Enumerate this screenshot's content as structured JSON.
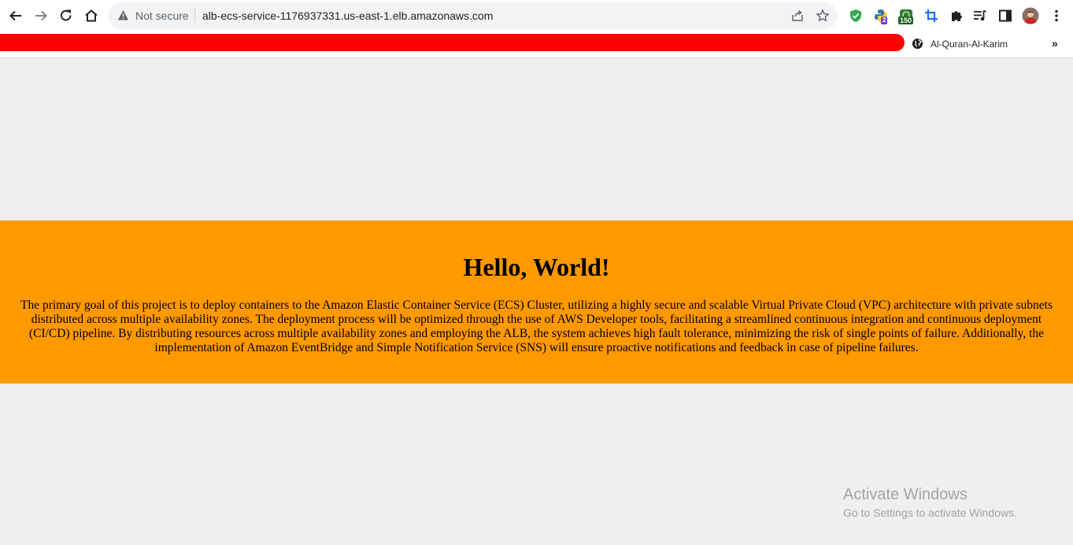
{
  "browser": {
    "back_icon": "arrow-left-icon",
    "forward_icon": "arrow-right-icon",
    "reload_icon": "reload-icon",
    "home_icon": "home-icon",
    "omnibox": {
      "security_label": "Not secure",
      "url": "alb-ecs-service-1176937331.us-east-1.elb.amazonaws.com"
    },
    "extensions": [
      {
        "name": "shield-extension-icon"
      },
      {
        "name": "python-extension-icon",
        "badge": "2"
      },
      {
        "name": "green-extension-icon",
        "badge": "150"
      },
      {
        "name": "crop-extension-icon"
      },
      {
        "name": "puzzle-extensions-icon"
      },
      {
        "name": "media-control-icon"
      },
      {
        "name": "side-panel-icon"
      },
      {
        "name": "profile-avatar"
      },
      {
        "name": "menu-kebab-icon"
      }
    ]
  },
  "bookmarks": {
    "items": [
      {
        "label": "Al-Quran-Al-Karim",
        "icon": "globe-icon"
      }
    ],
    "more_label": "»"
  },
  "page": {
    "heading": "Hello, World!",
    "paragraph": "The primary goal of this project is to deploy containers to the Amazon Elastic Container Service (ECS) Cluster, utilizing a highly secure and scalable Virtual Private Cloud (VPC) architecture with private subnets distributed across multiple availability zones. The deployment process will be optimized through the use of AWS Developer tools, facilitating a streamlined continuous integration and continuous deployment (CI/CD) pipeline. By distributing resources across multiple availability zones and employing the ALB, the system achieves high fault tolerance, minimizing the risk of single points of failure. Additionally, the implementation of Amazon EventBridge and Simple Notification Service (SNS) will ensure proactive notifications and feedback in case of pipeline failures.",
    "banner_color": "#ff9900",
    "background_color": "#efefef"
  },
  "watermark": {
    "title": "Activate Windows",
    "subtitle": "Go to Settings to activate Windows."
  }
}
